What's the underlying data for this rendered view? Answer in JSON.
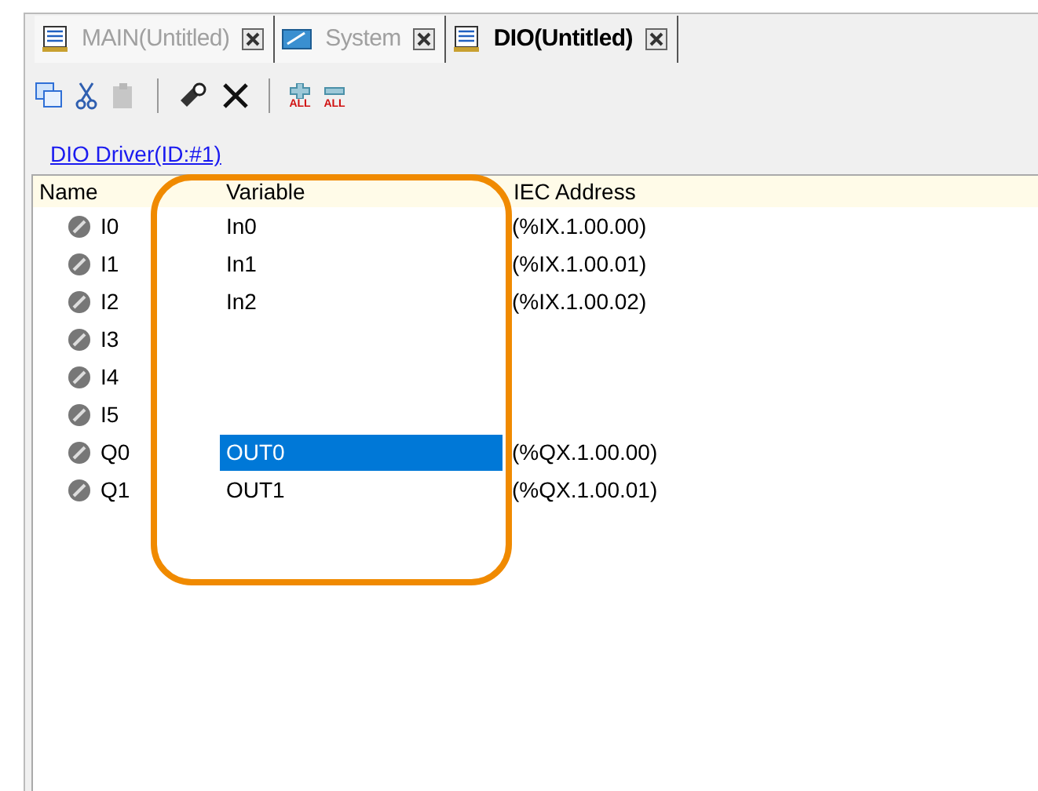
{
  "tabs": [
    {
      "label": "MAIN(Untitled)",
      "selected": false,
      "kind": "program"
    },
    {
      "label": "System",
      "selected": false,
      "kind": "system"
    },
    {
      "label": "DIO(Untitled)",
      "selected": true,
      "kind": "dio"
    }
  ],
  "toolbar": [
    {
      "kind": "copy",
      "disabled": false
    },
    {
      "kind": "cut",
      "disabled": false
    },
    {
      "kind": "paste",
      "disabled": true
    },
    {
      "kind": "sep"
    },
    {
      "kind": "stamp",
      "disabled": false
    },
    {
      "kind": "delete",
      "disabled": false
    },
    {
      "kind": "sep"
    },
    {
      "kind": "add-all",
      "label": "ALL",
      "disabled": false
    },
    {
      "kind": "remove-all",
      "label": "ALL",
      "disabled": false
    }
  ],
  "driver_link": "DIO Driver(ID:#1)",
  "table": {
    "columns": [
      "Name",
      "Variable",
      "IEC Address"
    ],
    "rows": [
      {
        "name": "I0",
        "variable": "In0",
        "address": "(%IX.1.00.00)",
        "selected": false
      },
      {
        "name": "I1",
        "variable": "In1",
        "address": "(%IX.1.00.01)",
        "selected": false
      },
      {
        "name": "I2",
        "variable": "In2",
        "address": "(%IX.1.00.02)",
        "selected": false
      },
      {
        "name": "I3",
        "selected": false
      },
      {
        "name": "I4",
        "selected": false
      },
      {
        "name": "I5",
        "selected": false
      },
      {
        "name": "Q0",
        "variable": "OUT0",
        "address": "(%QX.1.00.00)",
        "selected": true
      },
      {
        "name": "Q1",
        "variable": "OUT1",
        "address": "(%QX.1.00.01)",
        "selected": false
      }
    ]
  }
}
